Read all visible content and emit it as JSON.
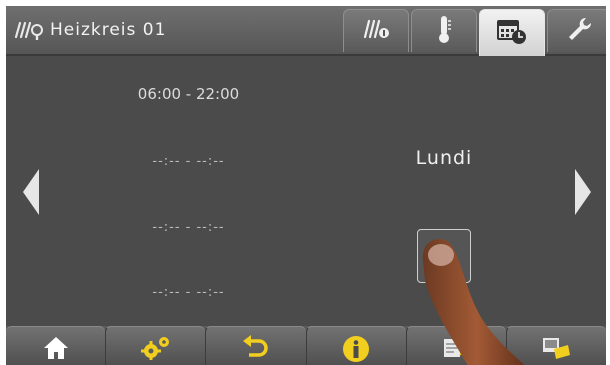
{
  "header": {
    "title": "Heizkreis 01",
    "tabs": [
      {
        "icon": "heating-status-icon",
        "active": false
      },
      {
        "icon": "thermometer-icon",
        "active": false
      },
      {
        "icon": "calendar-clock-icon",
        "active": true
      },
      {
        "icon": "wrench-icon",
        "active": false
      }
    ]
  },
  "schedule": {
    "slot_1": "06:00 - 22:00",
    "slot_2": "--:-- - --:--",
    "slot_3": "--:-- - --:--",
    "slot_4": "--:-- - --:--"
  },
  "day": "Lundi",
  "bottom_bar": [
    {
      "icon": "home-icon"
    },
    {
      "icon": "gears-icon"
    },
    {
      "icon": "back-arrow-icon"
    },
    {
      "icon": "info-icon"
    },
    {
      "icon": "notes-star-icon"
    },
    {
      "icon": "device-icon"
    }
  ],
  "colors": {
    "background": "#4b4b4b",
    "header": "#626262",
    "accent_yellow": "#f2cf1f",
    "text": "#f0f0f0"
  }
}
